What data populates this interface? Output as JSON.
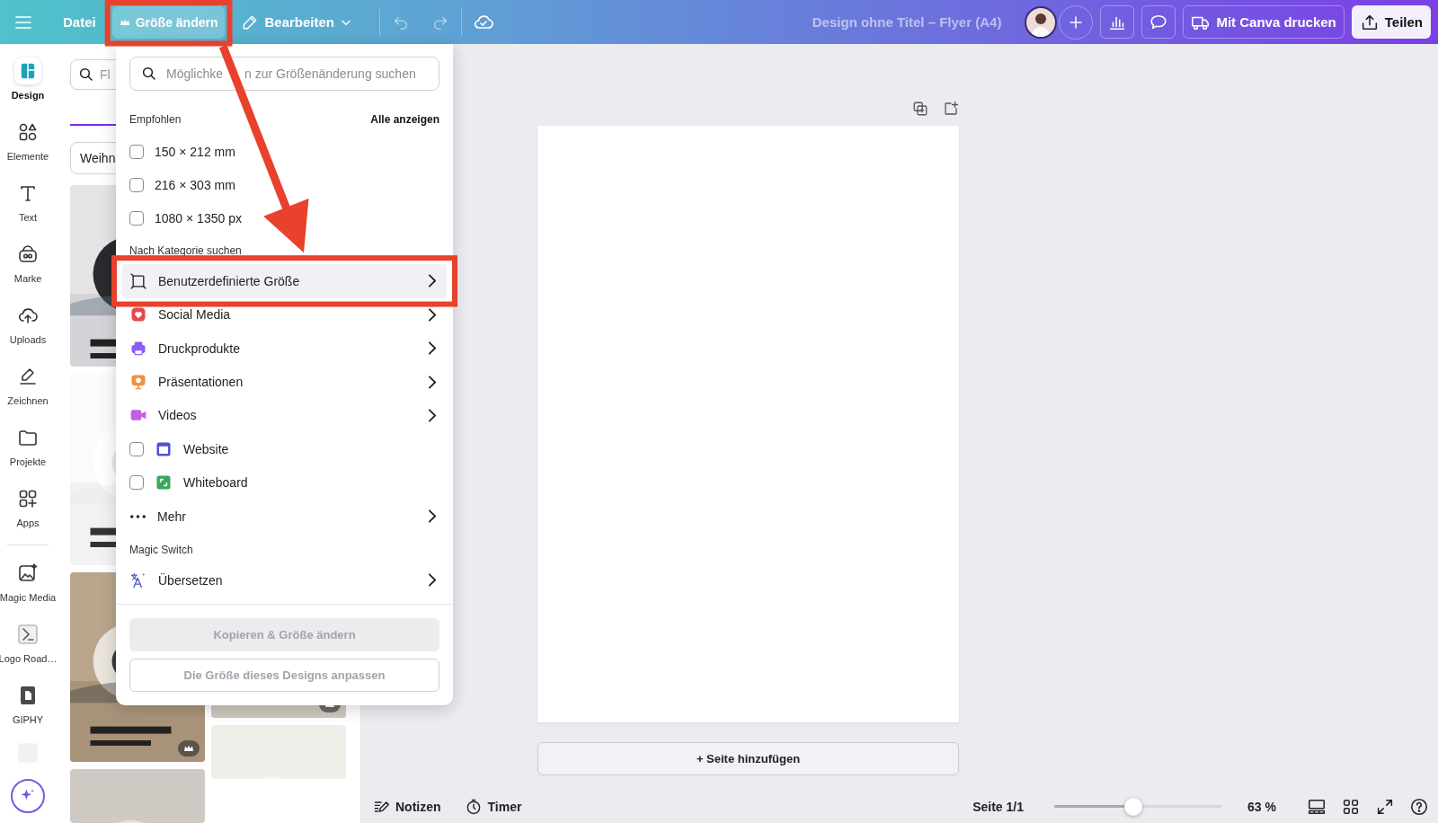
{
  "top_bar": {
    "menu_items": [
      {
        "label": "Datei",
        "selected": false
      },
      {
        "label": "Größe ändern",
        "selected": true
      },
      {
        "label": "Bearbeiten",
        "selected": false
      }
    ],
    "title": "Design ohne Titel – Flyer (A4)",
    "print_button": "Mit Canva drucken",
    "share_button": "Teilen"
  },
  "sidebar": {
    "items": [
      {
        "label": "Design",
        "selected": true
      },
      {
        "label": "Elemente",
        "selected": false
      },
      {
        "label": "Text",
        "selected": false
      },
      {
        "label": "Marke",
        "selected": false
      },
      {
        "label": "Uploads",
        "selected": false
      },
      {
        "label": "Zeichnen",
        "selected": false
      },
      {
        "label": "Projekte",
        "selected": false
      },
      {
        "label": "Apps",
        "selected": false
      },
      {
        "label": "Magic Media",
        "selected": false
      },
      {
        "label": "Logo Road…",
        "selected": false
      },
      {
        "label": "GIPHY",
        "selected": false
      }
    ]
  },
  "template_panel": {
    "search_placeholder": "Fl",
    "filter_chip": "Weihn",
    "columns": [
      [
        {
          "kind": "picture",
          "premium": false
        },
        {
          "kind": "picture",
          "premium": false
        },
        {
          "kind": "picture",
          "premium": true
        },
        {
          "kind": "picture",
          "premium": false
        }
      ],
      [
        {
          "kind": "picture",
          "premium": true
        },
        {
          "kind": "picture",
          "premium": false
        }
      ]
    ]
  },
  "resize_menu": {
    "search_placeholder_parts": [
      "Möglichke",
      "n zur Größenänderung suchen"
    ],
    "recommended_heading": "Empfohlen",
    "show_all_link": "Alle anzeigen",
    "recommended": [
      {
        "label": "150 × 212 mm",
        "checked": false
      },
      {
        "label": "216 × 303 mm",
        "checked": false
      },
      {
        "label": "1080 × 1350 px",
        "checked": false
      }
    ],
    "category_heading": "Nach Kategorie suchen",
    "categories": [
      {
        "kind": "submenu",
        "label": "Benutzerdefinierte Größe",
        "highlighted": true
      },
      {
        "kind": "submenu",
        "label": "Social Media",
        "color": "#e5484d",
        "highlighted": false
      },
      {
        "kind": "submenu",
        "label": "Druckprodukte",
        "color": "#8b5cf6",
        "highlighted": false
      },
      {
        "kind": "submenu",
        "label": "Präsentationen",
        "color": "#f0913a",
        "highlighted": false
      },
      {
        "kind": "submenu",
        "label": "Videos",
        "color": "#c45ce8",
        "highlighted": false
      },
      {
        "kind": "check",
        "label": "Website",
        "color": "#4c52d9",
        "checked": false,
        "highlighted": false
      },
      {
        "kind": "check",
        "label": "Whiteboard",
        "color": "#3ba55c",
        "checked": false,
        "highlighted": false
      },
      {
        "kind": "submenu",
        "label": "Mehr",
        "highlighted": false
      }
    ],
    "magic_heading": "Magic Switch",
    "magic_items": [
      {
        "label": "Übersetzen"
      }
    ],
    "buttons": [
      {
        "label": "Kopieren & Größe ändern",
        "disabled": true
      },
      {
        "label": "Die Größe dieses Designs anpassen",
        "disabled": true
      }
    ]
  },
  "canvas": {
    "add_page_button": "+ Seite hinzufügen"
  },
  "bottom_bar": {
    "notes": "Notizen",
    "timer": "Timer",
    "page_indicator": "Seite 1/1",
    "zoom": {
      "level": 0.47,
      "reading": "63 %"
    }
  }
}
